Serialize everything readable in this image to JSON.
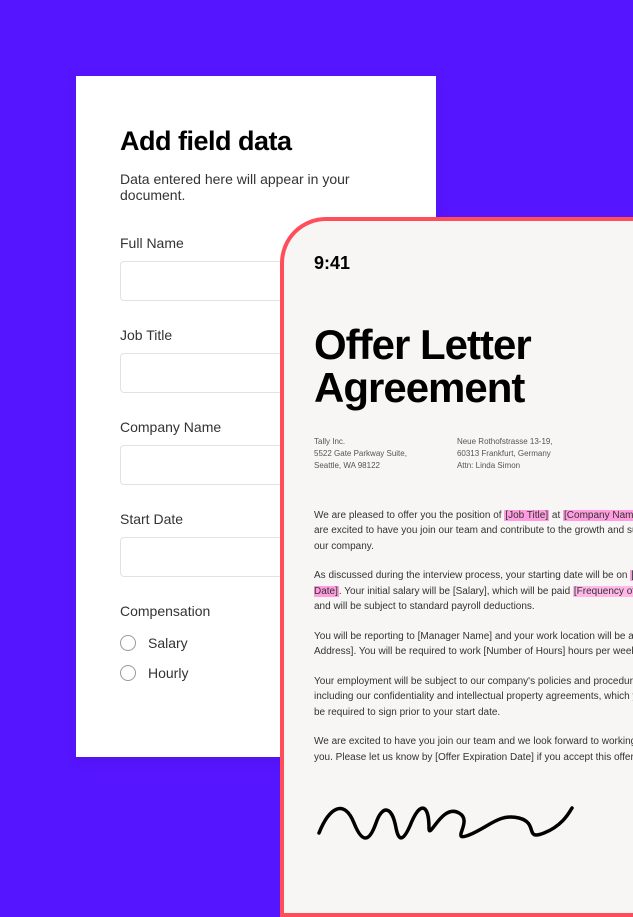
{
  "form": {
    "title": "Add field data",
    "subtitle": "Data entered here will appear in your document.",
    "fields": {
      "fullName": {
        "label": "Full Name",
        "value": ""
      },
      "jobTitle": {
        "label": "Job Title",
        "value": ""
      },
      "companyName": {
        "label": "Company Name",
        "value": ""
      },
      "startDate": {
        "label": "Start Date",
        "value": ""
      }
    },
    "compensation": {
      "label": "Compensation",
      "options": {
        "salary": "Salary",
        "hourly": "Hourly"
      }
    }
  },
  "phone": {
    "statusTime": "9:41",
    "doc": {
      "titleLine1": "Offer Letter",
      "titleLine2": "Agreement",
      "address1": {
        "line1": "Tally Inc.",
        "line2": "5522 Gate Parkway Suite,",
        "line3": "Seattle, WA 98122"
      },
      "address2": {
        "line1": "Neue Rothofstrasse 13-19,",
        "line2": "60313 Frankfurt, Germany",
        "line3": "Attn: Linda Simon"
      },
      "p1_a": "We are pleased to offer you the position of ",
      "p1_hl1": "[Job Title]",
      "p1_b": " at ",
      "p1_hl2": "[Company Name]",
      "p1_c": ". We are excited to have you join our team and contribute to the growth and success of our company.",
      "p2_a": "As discussed during the interview process, your starting date will be on ",
      "p2_hl1": "[Start Date]",
      "p2_b": ". Your initial salary will be [Salary], which will be paid ",
      "p2_hl2": "[Frequency of Pay]",
      "p2_c": " and will be subject to standard payroll deductions.",
      "p3": "You will be reporting to [Manager Name] and your work location will be at [Office Address]. You will be required to work [Number of Hours] hours per week.",
      "p4": "Your employment will be subject to our company's policies and procedures, including our confidentiality and intellectual property agreements, which you will be required to sign prior to your start date.",
      "p5": "We are excited to have you join our team and we look forward to working with you. Please let us know by [Offer Expiration Date] if you accept this offer."
    }
  }
}
